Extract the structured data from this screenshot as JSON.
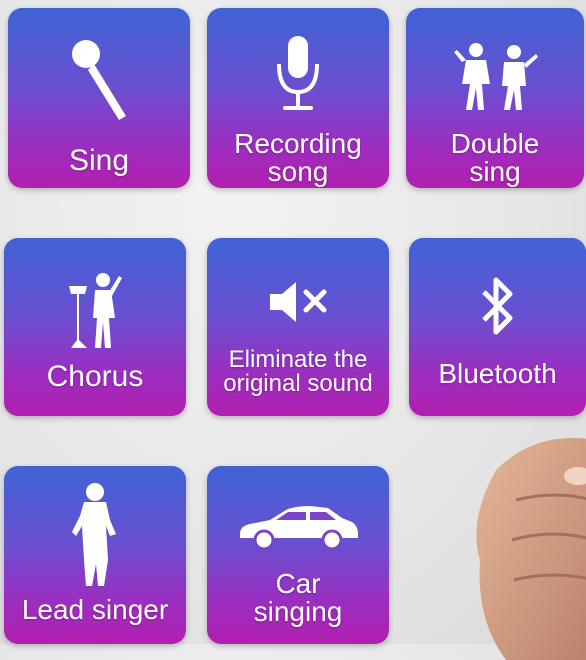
{
  "tiles": [
    {
      "id": "sing",
      "label_lines": [
        "Sing"
      ],
      "icon": "microphone-icon"
    },
    {
      "id": "recording",
      "label_lines": [
        "Recording",
        "song"
      ],
      "icon": "studio-mic-icon"
    },
    {
      "id": "double",
      "label_lines": [
        "Double",
        "sing"
      ],
      "icon": "duet-singers-icon"
    },
    {
      "id": "chorus",
      "label_lines": [
        "Chorus"
      ],
      "icon": "conductor-icon"
    },
    {
      "id": "eliminate",
      "label_lines": [
        "Eliminate the",
        "original sound"
      ],
      "icon": "mute-speaker-icon"
    },
    {
      "id": "bluetooth",
      "label_lines": [
        "Bluetooth"
      ],
      "icon": "bluetooth-icon"
    },
    {
      "id": "lead",
      "label_lines": [
        "Lead singer"
      ],
      "icon": "lead-singer-icon"
    },
    {
      "id": "car",
      "label_lines": [
        "Car",
        "singing"
      ],
      "icon": "car-icon"
    }
  ],
  "colors": {
    "tile_top": "#3f63d6",
    "tile_bottom": "#b21fb0",
    "text": "#ffffff"
  }
}
